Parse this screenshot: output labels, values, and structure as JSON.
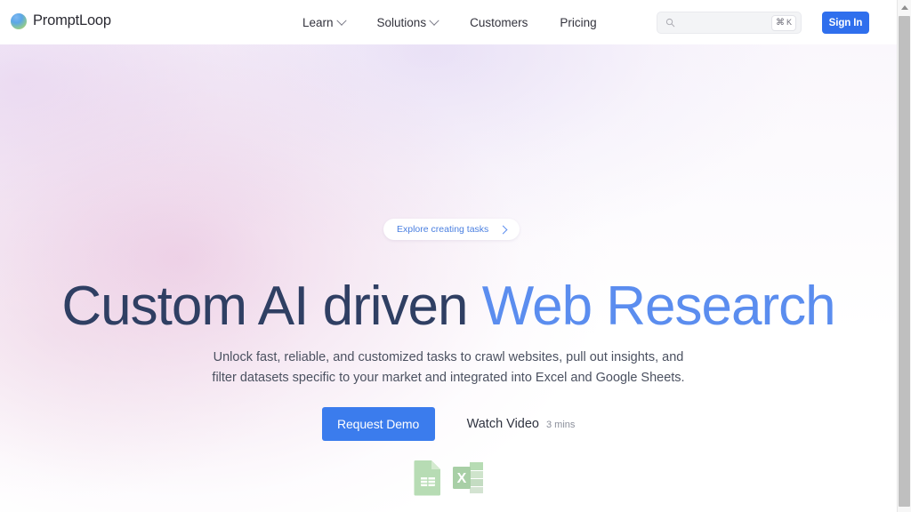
{
  "brand": {
    "name": "PromptLoop",
    "logo_icon": "gradient-circle-logo"
  },
  "nav": {
    "items": [
      {
        "label": "Learn",
        "has_dropdown": true
      },
      {
        "label": "Solutions",
        "has_dropdown": true
      },
      {
        "label": "Customers",
        "has_dropdown": false
      },
      {
        "label": "Pricing",
        "has_dropdown": false
      }
    ]
  },
  "search": {
    "value": "",
    "placeholder": "",
    "icon": "search-icon",
    "shortcut_modifier": "⌘",
    "shortcut_key": "K"
  },
  "header_actions": {
    "sign_in_label": "Sign In"
  },
  "hero": {
    "pill": {
      "label": "Explore creating tasks",
      "icon": "chevron-right-icon"
    },
    "headline": {
      "part_dark": "Custom AI driven ",
      "part_blue": "Web Research"
    },
    "subhead": {
      "line1": "Unlock fast, reliable, and customized tasks to crawl websites, pull out insights, and",
      "line2": "filter datasets specific to your market and integrated into Excel and Google Sheets."
    },
    "cta": {
      "demo_label": "Request Demo",
      "watch_label": "Watch Video",
      "watch_duration": "3 mins"
    },
    "integrations": [
      {
        "name": "google-sheets-icon"
      },
      {
        "name": "microsoft-excel-icon"
      }
    ]
  },
  "colors": {
    "accent_blue": "#2f6fed",
    "cta_blue": "#3b7ced",
    "headline_dark": "#2f3f63",
    "headline_blue": "#5b8def",
    "pill_text": "#4a7fe0",
    "integration_green": "#b7dcb4"
  },
  "scrollbar": {
    "up_arrow_icon": "scroll-up-arrow-icon"
  }
}
